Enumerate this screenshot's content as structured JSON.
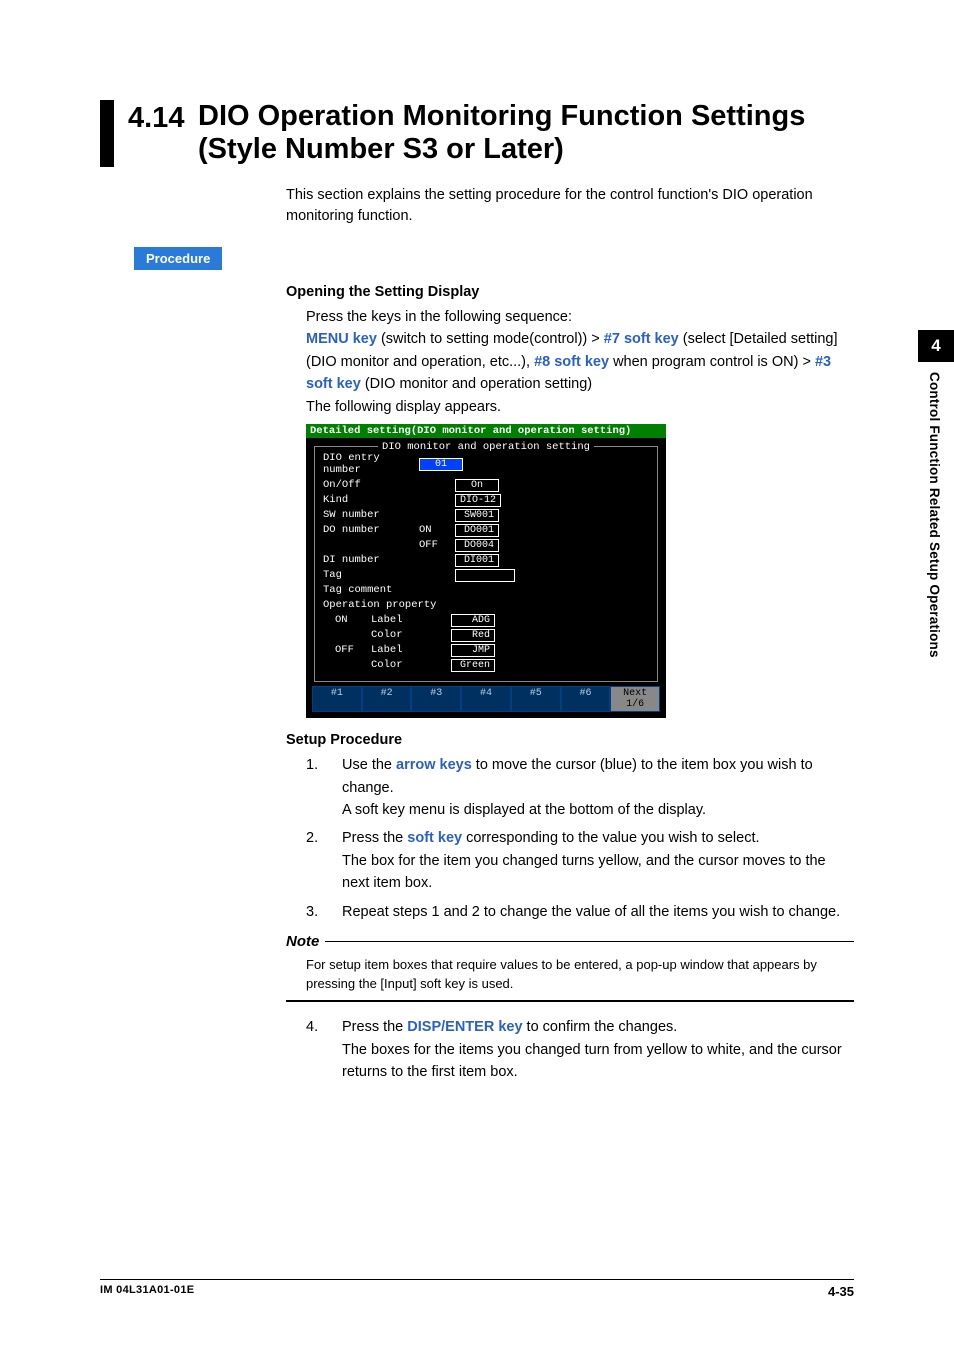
{
  "sideTab": {
    "num": "4",
    "label": "Control Function Related Setup Operations"
  },
  "heading": {
    "num": "4.14",
    "title1": "DIO Operation Monitoring Function Settings",
    "title2": "(Style Number S3 or Later)"
  },
  "intro": "This section explains the setting procedure for the control function's DIO operation monitoring function.",
  "procLabel": "Procedure",
  "open": {
    "head": "Opening the Setting Display",
    "l1": "Press the keys in the following sequence:",
    "menuKey": "MENU key",
    "t1": " (switch to setting mode(control)) > ",
    "sk7": "#7 soft key",
    "t2": " (select [Detailed setting] (DIO monitor and operation, etc...), ",
    "sk8": "#8 soft key",
    "t3": " when program control is ON) > ",
    "sk3": "#3 soft key",
    "t4": " (DIO monitor and operation setting)",
    "l3": "The following display appears."
  },
  "scr": {
    "title": "Detailed setting(DIO monitor and operation setting)",
    "legend": "DIO monitor and operation setting",
    "entryLabel": "DIO entry number",
    "entryVal": "01",
    "onoff": "On/Off",
    "onoffVal": "On",
    "kind": "Kind",
    "kindVal": "DIO-12",
    "sw": "SW number",
    "swVal": "SW001",
    "do": "DO number",
    "doOn": "ON",
    "doOnVal": "DO001",
    "doOff": "OFF",
    "doOffVal": "DO004",
    "di": "DI number",
    "diVal": "DI001",
    "tag": "Tag",
    "tagc": "Tag comment",
    "op": "Operation property",
    "opOn": "ON",
    "opOnLabel": "Label",
    "opOnLabelVal": "ADG",
    "opOnColor": "Color",
    "opOnColorVal": "Red",
    "opOff": "OFF",
    "opOffLabel": "Label",
    "opOffLabelVal": "JMP",
    "opOffColor": "Color",
    "opOffColorVal": "Green",
    "sk": [
      "#1",
      "#2",
      "#3",
      "#4",
      "#5",
      "#6",
      "Next 1/6"
    ]
  },
  "setup": {
    "head": "Setup Procedure",
    "s1a": "Use the ",
    "s1key": "arrow keys",
    "s1b": " to move the cursor (blue) to the item box you wish to change.",
    "s1c": "A soft key menu is displayed at the bottom of the display.",
    "s2a": "Press the ",
    "s2key": "soft key",
    "s2b": " corresponding to the value you wish to select.",
    "s2c": "The box for the item you changed turns yellow, and the cursor moves to the next item box.",
    "s3": "Repeat steps 1 and 2 to change the value of all the items you wish to change.",
    "s4a": "Press the ",
    "s4key": "DISP/ENTER key",
    "s4b": " to confirm the changes.",
    "s4c": "The boxes for the items you changed turn from yellow to white, and the cursor returns to the first item box."
  },
  "note": {
    "head": "Note",
    "body": "For setup item boxes that require values to be entered, a pop-up window that appears by pressing the [Input] soft key is used."
  },
  "footer": {
    "left": "IM 04L31A01-01E",
    "right": "4-35"
  }
}
